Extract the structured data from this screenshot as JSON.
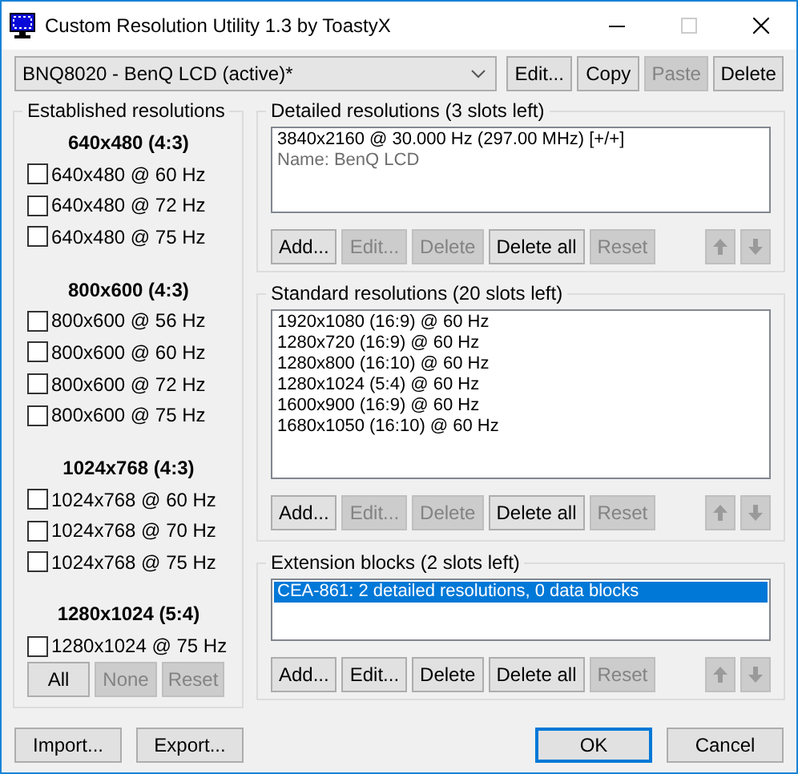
{
  "window": {
    "title": "Custom Resolution Utility 1.3 by ToastyX"
  },
  "device": {
    "selected_display": "BNQ8020 - BenQ LCD (active)*",
    "buttons": [
      {
        "label": "Edit...",
        "disabled": false
      },
      {
        "label": "Copy",
        "disabled": false
      },
      {
        "label": "Paste",
        "disabled": true
      },
      {
        "label": "Delete",
        "disabled": false
      }
    ]
  },
  "established": {
    "title": "Established resolutions",
    "groups": [
      {
        "heading": "640x480 (4:3)",
        "items": [
          {
            "label": "640x480 @ 60 Hz",
            "checked": false
          },
          {
            "label": "640x480 @ 72 Hz",
            "checked": false
          },
          {
            "label": "640x480 @ 75 Hz",
            "checked": false
          }
        ]
      },
      {
        "heading": "800x600 (4:3)",
        "items": [
          {
            "label": "800x600 @ 56 Hz",
            "checked": false
          },
          {
            "label": "800x600 @ 60 Hz",
            "checked": false
          },
          {
            "label": "800x600 @ 72 Hz",
            "checked": false
          },
          {
            "label": "800x600 @ 75 Hz",
            "checked": false
          }
        ]
      },
      {
        "heading": "1024x768 (4:3)",
        "items": [
          {
            "label": "1024x768 @ 60 Hz",
            "checked": false
          },
          {
            "label": "1024x768 @ 70 Hz",
            "checked": false
          },
          {
            "label": "1024x768 @ 75 Hz",
            "checked": false
          }
        ]
      },
      {
        "heading": "1280x1024 (5:4)",
        "items": [
          {
            "label": "1280x1024 @ 75 Hz",
            "checked": false
          }
        ]
      }
    ],
    "buttons": [
      {
        "label": "All",
        "disabled": false
      },
      {
        "label": "None",
        "disabled": true
      },
      {
        "label": "Reset",
        "disabled": true
      }
    ]
  },
  "panels": [
    {
      "title": "Detailed resolutions (3 slots left)",
      "items": [
        {
          "text": "3840x2160 @ 30.000 Hz (297.00 MHz) [+/+]",
          "kind": "entry",
          "selected": false
        },
        {
          "text": "Name: BenQ LCD",
          "kind": "note",
          "selected": false
        }
      ],
      "buttons": [
        {
          "label": "Add...",
          "disabled": false
        },
        {
          "label": "Edit...",
          "disabled": true
        },
        {
          "label": "Delete",
          "disabled": true
        },
        {
          "label": "Delete all",
          "disabled": false
        },
        {
          "label": "Reset",
          "disabled": true
        }
      ],
      "move_buttons": [
        {
          "kind": "up",
          "disabled": true
        },
        {
          "kind": "down",
          "disabled": true
        }
      ]
    },
    {
      "title": "Standard resolutions (20 slots left)",
      "items": [
        {
          "text": "1920x1080 (16:9) @ 60 Hz",
          "kind": "entry",
          "selected": false
        },
        {
          "text": "1280x720 (16:9) @ 60 Hz",
          "kind": "entry",
          "selected": false
        },
        {
          "text": "1280x800 (16:10) @ 60 Hz",
          "kind": "entry",
          "selected": false
        },
        {
          "text": "1280x1024 (5:4) @ 60 Hz",
          "kind": "entry",
          "selected": false
        },
        {
          "text": "1600x900 (16:9) @ 60 Hz",
          "kind": "entry",
          "selected": false
        },
        {
          "text": "1680x1050 (16:10) @ 60 Hz",
          "kind": "entry",
          "selected": false
        }
      ],
      "buttons": [
        {
          "label": "Add...",
          "disabled": false
        },
        {
          "label": "Edit...",
          "disabled": true
        },
        {
          "label": "Delete",
          "disabled": true
        },
        {
          "label": "Delete all",
          "disabled": false
        },
        {
          "label": "Reset",
          "disabled": true
        }
      ],
      "move_buttons": [
        {
          "kind": "up",
          "disabled": true
        },
        {
          "kind": "down",
          "disabled": true
        }
      ]
    },
    {
      "title": "Extension blocks (2 slots left)",
      "items": [
        {
          "text": "CEA-861: 2 detailed resolutions, 0 data blocks",
          "kind": "entry",
          "selected": true
        }
      ],
      "buttons": [
        {
          "label": "Add...",
          "disabled": false
        },
        {
          "label": "Edit...",
          "disabled": false
        },
        {
          "label": "Delete",
          "disabled": false
        },
        {
          "label": "Delete all",
          "disabled": false
        },
        {
          "label": "Reset",
          "disabled": true
        }
      ],
      "move_buttons": [
        {
          "kind": "up",
          "disabled": true
        },
        {
          "kind": "down",
          "disabled": true
        }
      ]
    }
  ],
  "file_buttons": [
    {
      "label": "Import...",
      "default": false
    },
    {
      "label": "Export...",
      "default": false
    }
  ],
  "dialog_buttons": [
    {
      "label": "OK",
      "default": true
    },
    {
      "label": "Cancel",
      "default": false
    }
  ]
}
